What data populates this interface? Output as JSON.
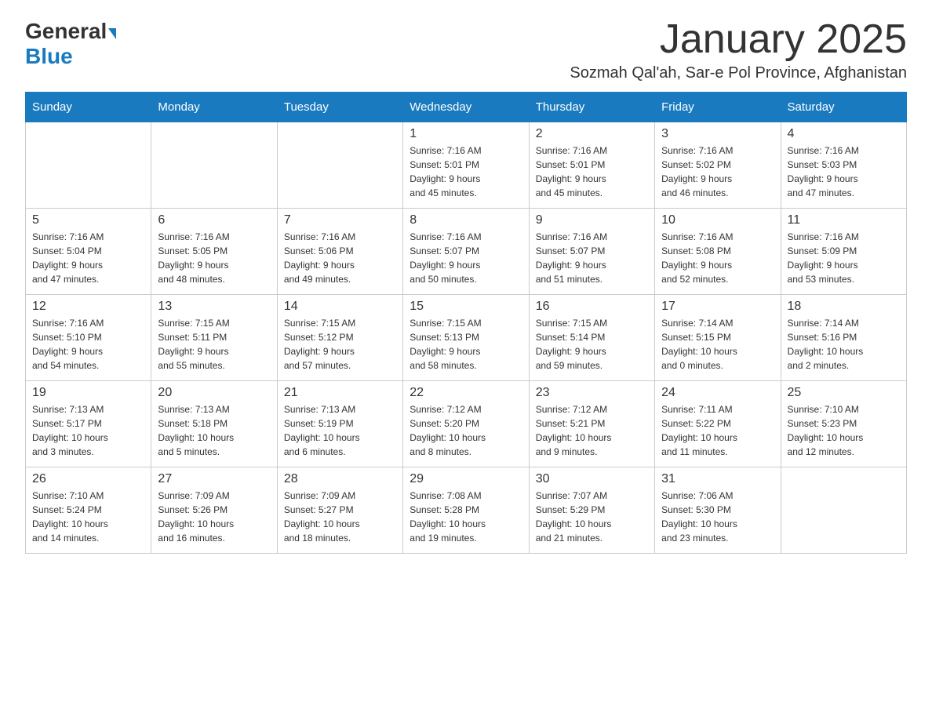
{
  "header": {
    "logo_general": "General",
    "logo_blue": "Blue",
    "month_title": "January 2025",
    "location": "Sozmah Qal'ah, Sar-e Pol Province, Afghanistan"
  },
  "days_of_week": [
    "Sunday",
    "Monday",
    "Tuesday",
    "Wednesday",
    "Thursday",
    "Friday",
    "Saturday"
  ],
  "weeks": [
    [
      {
        "day": "",
        "info": ""
      },
      {
        "day": "",
        "info": ""
      },
      {
        "day": "",
        "info": ""
      },
      {
        "day": "1",
        "info": "Sunrise: 7:16 AM\nSunset: 5:01 PM\nDaylight: 9 hours\nand 45 minutes."
      },
      {
        "day": "2",
        "info": "Sunrise: 7:16 AM\nSunset: 5:01 PM\nDaylight: 9 hours\nand 45 minutes."
      },
      {
        "day": "3",
        "info": "Sunrise: 7:16 AM\nSunset: 5:02 PM\nDaylight: 9 hours\nand 46 minutes."
      },
      {
        "day": "4",
        "info": "Sunrise: 7:16 AM\nSunset: 5:03 PM\nDaylight: 9 hours\nand 47 minutes."
      }
    ],
    [
      {
        "day": "5",
        "info": "Sunrise: 7:16 AM\nSunset: 5:04 PM\nDaylight: 9 hours\nand 47 minutes."
      },
      {
        "day": "6",
        "info": "Sunrise: 7:16 AM\nSunset: 5:05 PM\nDaylight: 9 hours\nand 48 minutes."
      },
      {
        "day": "7",
        "info": "Sunrise: 7:16 AM\nSunset: 5:06 PM\nDaylight: 9 hours\nand 49 minutes."
      },
      {
        "day": "8",
        "info": "Sunrise: 7:16 AM\nSunset: 5:07 PM\nDaylight: 9 hours\nand 50 minutes."
      },
      {
        "day": "9",
        "info": "Sunrise: 7:16 AM\nSunset: 5:07 PM\nDaylight: 9 hours\nand 51 minutes."
      },
      {
        "day": "10",
        "info": "Sunrise: 7:16 AM\nSunset: 5:08 PM\nDaylight: 9 hours\nand 52 minutes."
      },
      {
        "day": "11",
        "info": "Sunrise: 7:16 AM\nSunset: 5:09 PM\nDaylight: 9 hours\nand 53 minutes."
      }
    ],
    [
      {
        "day": "12",
        "info": "Sunrise: 7:16 AM\nSunset: 5:10 PM\nDaylight: 9 hours\nand 54 minutes."
      },
      {
        "day": "13",
        "info": "Sunrise: 7:15 AM\nSunset: 5:11 PM\nDaylight: 9 hours\nand 55 minutes."
      },
      {
        "day": "14",
        "info": "Sunrise: 7:15 AM\nSunset: 5:12 PM\nDaylight: 9 hours\nand 57 minutes."
      },
      {
        "day": "15",
        "info": "Sunrise: 7:15 AM\nSunset: 5:13 PM\nDaylight: 9 hours\nand 58 minutes."
      },
      {
        "day": "16",
        "info": "Sunrise: 7:15 AM\nSunset: 5:14 PM\nDaylight: 9 hours\nand 59 minutes."
      },
      {
        "day": "17",
        "info": "Sunrise: 7:14 AM\nSunset: 5:15 PM\nDaylight: 10 hours\nand 0 minutes."
      },
      {
        "day": "18",
        "info": "Sunrise: 7:14 AM\nSunset: 5:16 PM\nDaylight: 10 hours\nand 2 minutes."
      }
    ],
    [
      {
        "day": "19",
        "info": "Sunrise: 7:13 AM\nSunset: 5:17 PM\nDaylight: 10 hours\nand 3 minutes."
      },
      {
        "day": "20",
        "info": "Sunrise: 7:13 AM\nSunset: 5:18 PM\nDaylight: 10 hours\nand 5 minutes."
      },
      {
        "day": "21",
        "info": "Sunrise: 7:13 AM\nSunset: 5:19 PM\nDaylight: 10 hours\nand 6 minutes."
      },
      {
        "day": "22",
        "info": "Sunrise: 7:12 AM\nSunset: 5:20 PM\nDaylight: 10 hours\nand 8 minutes."
      },
      {
        "day": "23",
        "info": "Sunrise: 7:12 AM\nSunset: 5:21 PM\nDaylight: 10 hours\nand 9 minutes."
      },
      {
        "day": "24",
        "info": "Sunrise: 7:11 AM\nSunset: 5:22 PM\nDaylight: 10 hours\nand 11 minutes."
      },
      {
        "day": "25",
        "info": "Sunrise: 7:10 AM\nSunset: 5:23 PM\nDaylight: 10 hours\nand 12 minutes."
      }
    ],
    [
      {
        "day": "26",
        "info": "Sunrise: 7:10 AM\nSunset: 5:24 PM\nDaylight: 10 hours\nand 14 minutes."
      },
      {
        "day": "27",
        "info": "Sunrise: 7:09 AM\nSunset: 5:26 PM\nDaylight: 10 hours\nand 16 minutes."
      },
      {
        "day": "28",
        "info": "Sunrise: 7:09 AM\nSunset: 5:27 PM\nDaylight: 10 hours\nand 18 minutes."
      },
      {
        "day": "29",
        "info": "Sunrise: 7:08 AM\nSunset: 5:28 PM\nDaylight: 10 hours\nand 19 minutes."
      },
      {
        "day": "30",
        "info": "Sunrise: 7:07 AM\nSunset: 5:29 PM\nDaylight: 10 hours\nand 21 minutes."
      },
      {
        "day": "31",
        "info": "Sunrise: 7:06 AM\nSunset: 5:30 PM\nDaylight: 10 hours\nand 23 minutes."
      },
      {
        "day": "",
        "info": ""
      }
    ]
  ]
}
